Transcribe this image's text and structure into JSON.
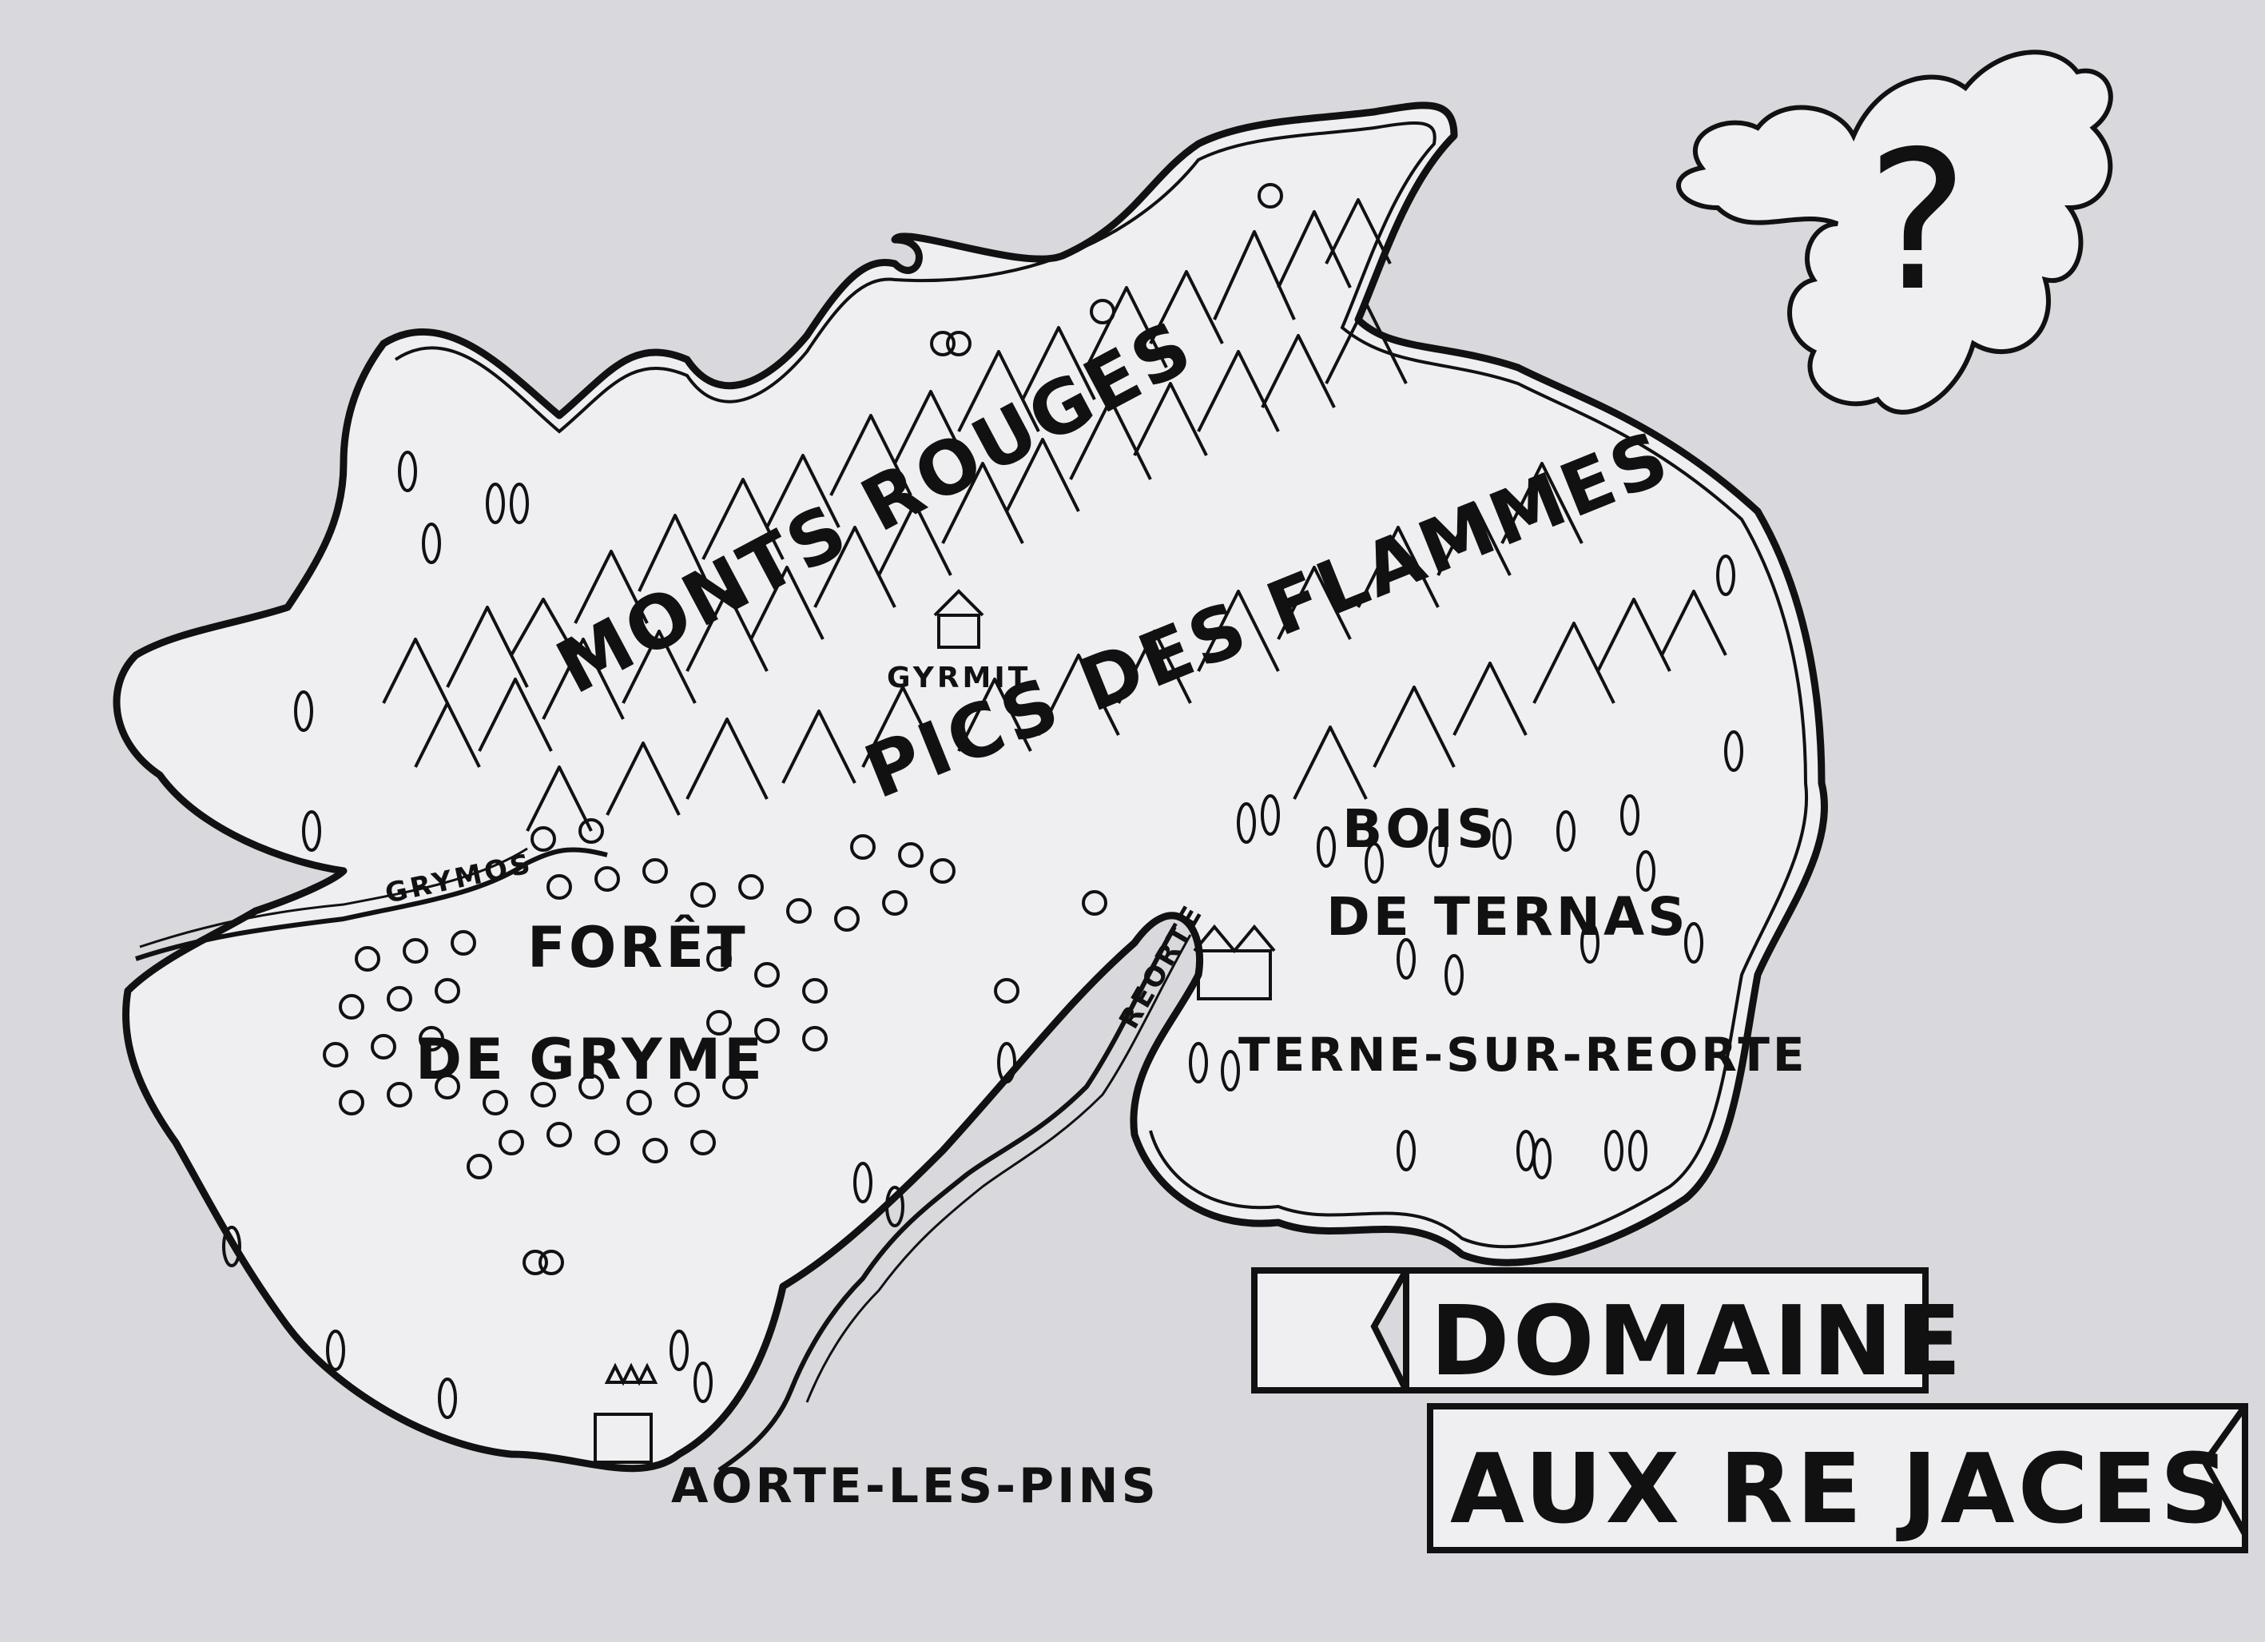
{
  "map": {
    "title_line1": "DOMAINE",
    "title_line2": "AUX RE JACES",
    "unknown_marker": "?",
    "regions": {
      "mountains_north": "MONTS ROUGES",
      "mountains_east": "PICS DES FLAMMES",
      "forest_west_line1": "FORÊT",
      "forest_west_line2": "DE GRYME",
      "woods_east_line1": "BOIS",
      "woods_east_line2": "DE TERNAS"
    },
    "rivers": {
      "west": "GRYMOS",
      "east": "REORTE"
    },
    "towns": {
      "mountain_town": "GYRMIT",
      "east_town": "TERNE-SUR-REORTE",
      "south_town": "AORTE-LES-PINS"
    },
    "colors": {
      "paper": "#d9d8dc",
      "ink": "#111111",
      "land": "#efeef1"
    }
  }
}
